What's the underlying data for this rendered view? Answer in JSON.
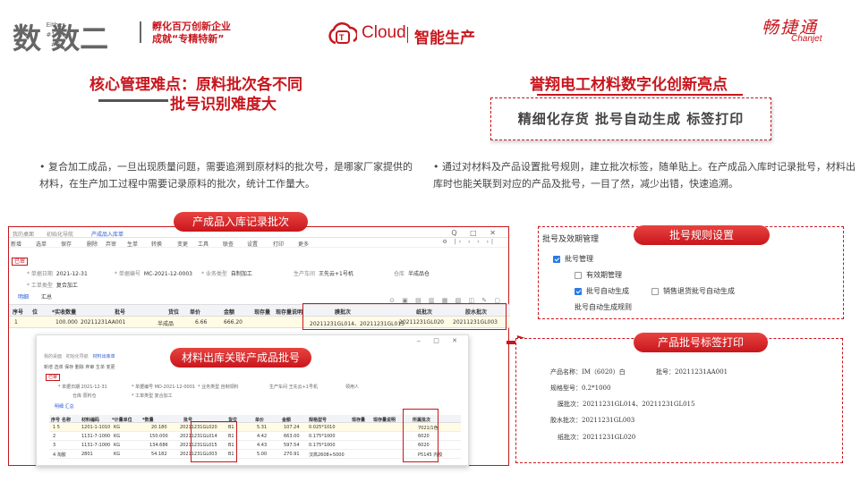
{
  "header": {
    "logo_main": "数 数二",
    "logo_small_1": "Either",
    "logo_small_2": "#1 Or #2",
    "slogan_1": "孵化百万创新企业",
    "slogan_2": "成就“专精特新”",
    "cloud_text": "Cloud",
    "cloud_label": "智能生产",
    "brand_cn": "畅捷通",
    "brand_en": "Chanjet"
  },
  "left": {
    "title_line1": "核心管理难点：原料批次各不同",
    "title_line2": "批号识别难度大",
    "desc": "•  复合加工成品，一旦出现质量问题，需要追溯到原材料的批次号，是哪家厂家提供的材料，在生产加工过程中需要记录原料的批次，统计工作量大。"
  },
  "right": {
    "title": "誉翔电工材料数字化创新亮点",
    "highlights": "精细化存货   批号自动生成  标签打印",
    "desc": "•  通过对材料及产品设置批号规则，建立批次标签，随单贴上。在产成品入库时记录批号，材料出库时也能关联到对应的产品及批号，一目了然，减少出错，快速追溯。"
  },
  "pills": {
    "inbound": "产成品入库记录批次",
    "outbound": "材料出库关联产成品批号",
    "rule": "批号规则设置",
    "print": "产品批号标签打印"
  },
  "erp": {
    "tabs": [
      "我的桌面",
      "初始化导航",
      "产成品入库单"
    ],
    "menu": [
      "新增",
      "选单",
      "保存",
      "删除",
      "弃审",
      "生单",
      "转换",
      "变更",
      "工具",
      "联查",
      "设置",
      "打印",
      "更多"
    ],
    "status": "已审",
    "fields": {
      "date_label": "* 单据日期",
      "date": "2021-12-31",
      "code_label": "* 单据编号",
      "code": "MC-2021-12-0003",
      "biz_label": "* 业务类型",
      "biz": "自制加工",
      "dept_label": "生产车间",
      "dept": "王先云+1号机",
      "wh_label": "仓库",
      "wh": "半成品仓",
      "work_label": "* 工单类型",
      "work": "复合加工"
    },
    "subtabs": [
      "明细",
      "汇总"
    ],
    "columns": [
      "序号",
      "位",
      "*实收数量",
      "批号",
      "货位",
      "单价",
      "金额",
      "现存量",
      "现存量说明",
      "膜批次",
      "纸批次",
      "胶水批次"
    ],
    "row": {
      "seq": "1",
      "qty": "100.000",
      "batch": "20211231AA001",
      "loc": "半成品",
      "price": "6.66",
      "amount": "666.20",
      "film": "20211231GL014、20211231GL015",
      "paper": "20211231GL020",
      "glue": "20211231GL003"
    }
  },
  "erp2": {
    "tabs": [
      "我的桌面",
      "初始化导航",
      "材料出库单"
    ],
    "menu": "新增  选单  保存  删除  弃审  生单  变更",
    "status": "已审",
    "f1": "* 单据日期  2021-12-31",
    "f2": "* 单据编号  MD-2021-12-0001",
    "f3": "* 业务类型  自制领料",
    "f4": "生产车间  王先云+1号机",
    "f5": "领用人",
    "f6": "仓库  原料仓",
    "f7": "* 工单类型  复合加工",
    "subtabs": "明细    汇总",
    "columns": [
      "序号",
      "名称",
      "材料编码",
      "*计量单位",
      "*数量",
      "批号",
      "货位",
      "单价",
      "金额",
      "规格型号",
      "现存量",
      "现存量说明",
      "所属批次"
    ],
    "rows": [
      {
        "seq": "1  5",
        "code": "1201-1-1010",
        "unit": "KG",
        "qty": "20.180",
        "batch": "20211231GL020",
        "loc": "B1",
        "price": "5.31",
        "amount": "107.24",
        "spec": "0.025*1010",
        "lot": "7021/1色"
      },
      {
        "seq": "2",
        "code": "1131-7-1000",
        "unit": "KG",
        "qty": "150.000",
        "batch": "20211231GL014",
        "loc": "B1",
        "price": "4.42",
        "amount": "663.00",
        "spec": "0.175*1000",
        "lot": "6020"
      },
      {
        "seq": "3",
        "code": "1131-7-1000",
        "unit": "KG",
        "qty": "134.686",
        "batch": "20211231GL015",
        "loc": "B1",
        "price": "4.43",
        "amount": "597.54",
        "spec": "0.175*1000",
        "lot": "6020"
      },
      {
        "seq": "4  淘胶",
        "code": "2801",
        "unit": "KG",
        "qty": "54.182",
        "batch": "20211231GL003",
        "loc": "B1",
        "price": "5.00",
        "amount": "270.91",
        "spec": "汉高2608+5000",
        "lot": "P5145 内胶"
      }
    ]
  },
  "batch_panel": {
    "title": "批号及效期管理",
    "items": [
      "批号管理",
      "有效期管理",
      "批号自动生成",
      "销售退货批号自动生成",
      "批号自动生成规则"
    ]
  },
  "label_panel": {
    "name_label": "产品名称：",
    "name": "IM（6020）白",
    "batch_label": "批号：",
    "batch": "20211231AA001",
    "spec_label": "规格型号：",
    "spec": "0.2*1000",
    "film_label": "膜批次：",
    "film": "20211231GL014、20211231GL015",
    "glue_label": "胶水批次：",
    "glue": "20211231GL003",
    "paper_label": "纸批次：",
    "paper": "20211231GL020"
  }
}
